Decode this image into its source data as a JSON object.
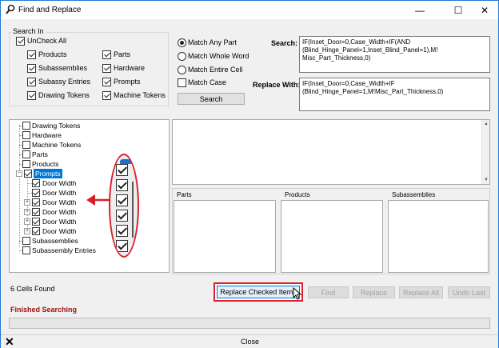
{
  "window": {
    "title": "Find and Replace",
    "minimize_glyph": "—",
    "maximize_glyph": "☐",
    "close_glyph": "✕"
  },
  "search_in": {
    "title": "Search In",
    "uncheck_all": {
      "label": "UnCheck All",
      "checked": true
    },
    "items": [
      {
        "label": "Products",
        "checked": true
      },
      {
        "label": "Subassemblies",
        "checked": true
      },
      {
        "label": "Subassy Entries",
        "checked": true
      },
      {
        "label": "Drawing Tokens",
        "checked": true
      },
      {
        "label": "Parts",
        "checked": true
      },
      {
        "label": "Hardware",
        "checked": true
      },
      {
        "label": "Prompts",
        "checked": true
      },
      {
        "label": "Machine Tokens",
        "checked": true
      }
    ]
  },
  "match_options": {
    "radios": [
      {
        "label": "Match Any Part",
        "checked": true
      },
      {
        "label": "Match Whole Word",
        "checked": false
      },
      {
        "label": "Match Entire Cell",
        "checked": false
      }
    ],
    "match_case": {
      "label": "Match Case",
      "checked": false
    },
    "search_button": "Search"
  },
  "search": {
    "label": "Search:",
    "value": "IF(Inset_Door=0,Case_Width+IF(AND\n(Blind_Hinge_Panel=1,Inset_Blind_Panel=1),M!\nMisc_Part_Thickness,0)"
  },
  "replace": {
    "label": "Replace With:",
    "value": "IF(Inset_Door=0,Case_Width+IF\n(Blind_Hinge_Panel=1,M!Misc_Part_Thickness,0)"
  },
  "tree": {
    "nodes": [
      {
        "label": "Drawing Tokens",
        "checked": false
      },
      {
        "label": "Hardware",
        "checked": false
      },
      {
        "label": "Machine Tokens",
        "checked": false
      },
      {
        "label": "Parts",
        "checked": false
      },
      {
        "label": "Products",
        "checked": false
      },
      {
        "label": "Prompts",
        "checked": true,
        "expanded": true,
        "selected": true
      },
      {
        "label": "Door Width",
        "checked": true
      },
      {
        "label": "Door Width",
        "checked": true
      },
      {
        "label": "Door Width",
        "checked": true
      },
      {
        "label": "Door Width",
        "checked": true
      },
      {
        "label": "Door Width",
        "checked": true
      },
      {
        "label": "Door Width",
        "checked": true
      },
      {
        "label": "Subassemblies",
        "checked": false
      },
      {
        "label": "Subassembly Entries",
        "checked": false
      }
    ]
  },
  "panels": {
    "parts": "Parts",
    "products": "Products",
    "subassemblies": "Subassemblies"
  },
  "status": {
    "cells_found": "6 Cells Found",
    "finished": "Finished Searching",
    "finished_color": "#a01010"
  },
  "actions": {
    "replace_checked": "Replace Checked Items",
    "find": "Find",
    "replace": "Replace",
    "replace_all": "Replace All",
    "undo_last": "Undo Last"
  },
  "footer": {
    "close": "Close",
    "x_glyph": "✕"
  },
  "annotation": {
    "color": "#d9202a"
  }
}
